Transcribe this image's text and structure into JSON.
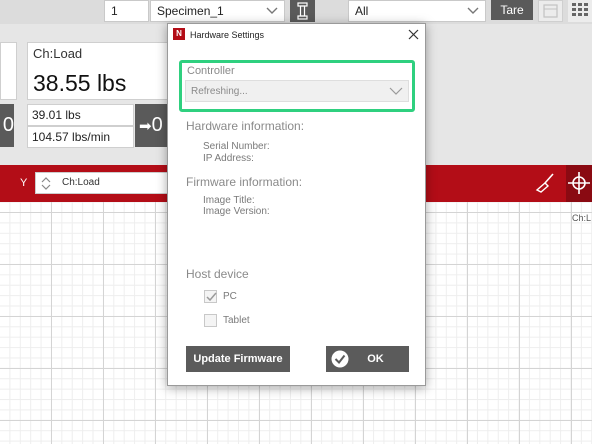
{
  "toolbar": {
    "step_value": "1",
    "specimen_value": "Specimen_1",
    "filter_value": "All",
    "tare_label": "Tare"
  },
  "readout": {
    "channel_label": "Ch:Load",
    "main_value": "38.55 lbs",
    "sub_value_1": "39.01 lbs",
    "sub_value_2": "104.57 lbs/min",
    "left_zero_label": "0",
    "right_zero_label": "0"
  },
  "graphbar": {
    "axis_label": "Y",
    "channel_select": "Ch:Load",
    "right_edge_label": "Ch:L"
  },
  "dialog": {
    "title": "Hardware Settings",
    "logo_letter": "N",
    "controller_label": "Controller",
    "controller_select": "Refreshing...",
    "hardware_info_label": "Hardware information:",
    "serial_label": "Serial Number:",
    "ip_label": "IP Address:",
    "firmware_info_label": "Firmware information:",
    "image_title_label": "Image Title:",
    "image_version_label": "Image Version:",
    "host_device_label": "Host device",
    "pc_label": "PC",
    "pc_checked": true,
    "tablet_label": "Tablet",
    "tablet_checked": false,
    "update_button": "Update Firmware",
    "ok_button": "OK",
    "highlight_color": "#2fd07f"
  },
  "colors": {
    "accent_red": "#b30d17",
    "dark_button": "#5a5a5a"
  }
}
